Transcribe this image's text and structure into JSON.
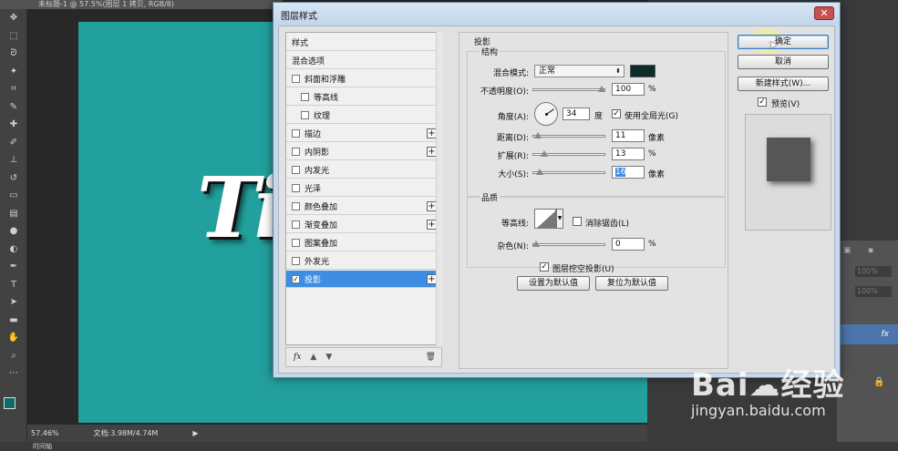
{
  "photoshop": {
    "doc_tab": "未标题-1 @ 57.5%(图层 1 拷贝, RGB/8)",
    "zoom": "57.46%",
    "doc_info": "文档:3.98M/4.74M",
    "bottom_label": "时间轴",
    "canvas_text": "Ti",
    "opacity_1": "100%",
    "opacity_2": "100%",
    "fx_badge": "fx"
  },
  "dialog": {
    "title": "图层样式",
    "close_icon": "close-icon",
    "style_list": [
      {
        "label": "样式",
        "checkbox": false,
        "plus": false,
        "indent": 0,
        "checked": false
      },
      {
        "label": "混合选项",
        "checkbox": false,
        "plus": false,
        "indent": 0,
        "checked": false
      },
      {
        "label": "斜面和浮雕",
        "checkbox": true,
        "plus": false,
        "indent": 0,
        "checked": false
      },
      {
        "label": "等高线",
        "checkbox": true,
        "plus": false,
        "indent": 1,
        "checked": false
      },
      {
        "label": "纹理",
        "checkbox": true,
        "plus": false,
        "indent": 1,
        "checked": false
      },
      {
        "label": "描边",
        "checkbox": true,
        "plus": true,
        "indent": 0,
        "checked": false
      },
      {
        "label": "内阴影",
        "checkbox": true,
        "plus": true,
        "indent": 0,
        "checked": false
      },
      {
        "label": "内发光",
        "checkbox": true,
        "plus": false,
        "indent": 0,
        "checked": false
      },
      {
        "label": "光泽",
        "checkbox": true,
        "plus": false,
        "indent": 0,
        "checked": false
      },
      {
        "label": "颜色叠加",
        "checkbox": true,
        "plus": true,
        "indent": 0,
        "checked": false
      },
      {
        "label": "渐变叠加",
        "checkbox": true,
        "plus": true,
        "indent": 0,
        "checked": false
      },
      {
        "label": "图案叠加",
        "checkbox": true,
        "plus": false,
        "indent": 0,
        "checked": false
      },
      {
        "label": "外发光",
        "checkbox": true,
        "plus": false,
        "indent": 0,
        "checked": false
      },
      {
        "label": "投影",
        "checkbox": true,
        "plus": true,
        "indent": 0,
        "checked": true,
        "selected": true
      }
    ],
    "footer": {
      "fx": "fx",
      "up": "▲",
      "down": "▼",
      "trash": "🗑"
    },
    "drop_shadow": {
      "section_title": "投影",
      "structure_title": "结构",
      "blend_mode_label": "混合模式:",
      "blend_mode_value": "正常",
      "shadow_color": "#0d2d2a",
      "opacity_label": "不透明度(O):",
      "opacity_value": "100",
      "opacity_fraction": 1.0,
      "angle_label": "角度(A):",
      "angle_value": "34",
      "angle_unit": "度",
      "global_light_label": "使用全局光(G)",
      "global_light_checked": true,
      "distance_label": "距离(D):",
      "distance_value": "11",
      "distance_fraction": 0.03,
      "spread_label": "扩展(R):",
      "spread_value": "13",
      "spread_fraction": 0.13,
      "size_label": "大小(S):",
      "size_value": "16",
      "size_fraction": 0.06,
      "unit_pixels": "像素",
      "unit_percent": "%",
      "quality_title": "品质",
      "contour_label": "等高线:",
      "antialias_label": "消除锯齿(L)",
      "antialias_checked": false,
      "noise_label": "杂色(N):",
      "noise_value": "0",
      "noise_fraction": 0.0,
      "knockout_label": "图层挖空投影(U)",
      "knockout_checked": true,
      "make_default": "设置为默认值",
      "reset_default": "复位为默认值"
    },
    "buttons": {
      "ok": "确定",
      "cancel": "取消",
      "new_style": "新建样式(W)...",
      "preview_label": "预览(V)",
      "preview_checked": true
    }
  },
  "watermark": {
    "logo": "Bai☁经验",
    "url": "jingyan.baidu.com"
  }
}
